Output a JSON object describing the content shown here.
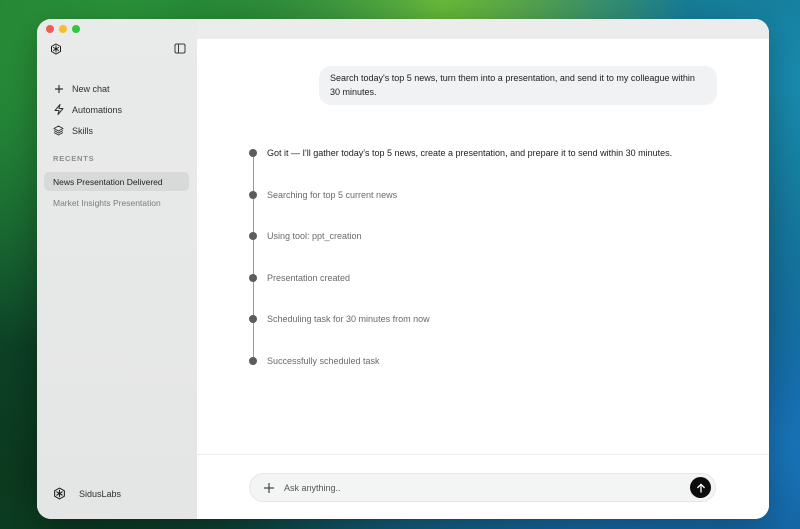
{
  "window": {
    "traffic_lights": [
      "close",
      "minimize",
      "maximize"
    ]
  },
  "sidebar": {
    "logo_icon": "snowflake-logo-icon",
    "toggle_icon": "sidebar-toggle-icon",
    "nav": [
      {
        "label": "New chat",
        "icon": "plus-icon"
      },
      {
        "label": "Automations",
        "icon": "bolt-icon"
      },
      {
        "label": "Skills",
        "icon": "layers-icon"
      }
    ],
    "recents_label": "RECENTS",
    "recents": [
      {
        "label": "News Presentation Delivered",
        "active": true
      },
      {
        "label": "Market Insights Presentation",
        "active": false
      }
    ],
    "account": {
      "name": "SidusLabs",
      "icon": "snowflake-logo-icon"
    }
  },
  "chat": {
    "user_message": "Search today's top 5 news, turn them into a presentation, and send it to my colleague within 30 minutes.",
    "steps": [
      "Got it — I'll gather today's top 5 news, create a presentation, and prepare it to send within 30 minutes.",
      "Searching for top 5 current news",
      "Using tool: ppt_creation",
      "Presentation created",
      "Scheduling task for 30 minutes from now",
      "Successfully scheduled task"
    ]
  },
  "composer": {
    "placeholder": "Ask anything..",
    "value": "",
    "send_icon": "arrow-up-icon",
    "attach_icon": "plus-icon"
  },
  "colors": {
    "sidebar_bg": "#e6e8e7",
    "active_recent_bg": "#d8dad9",
    "send_button": "#0d0d0d",
    "bubble_bg": "#f1f2f3"
  }
}
